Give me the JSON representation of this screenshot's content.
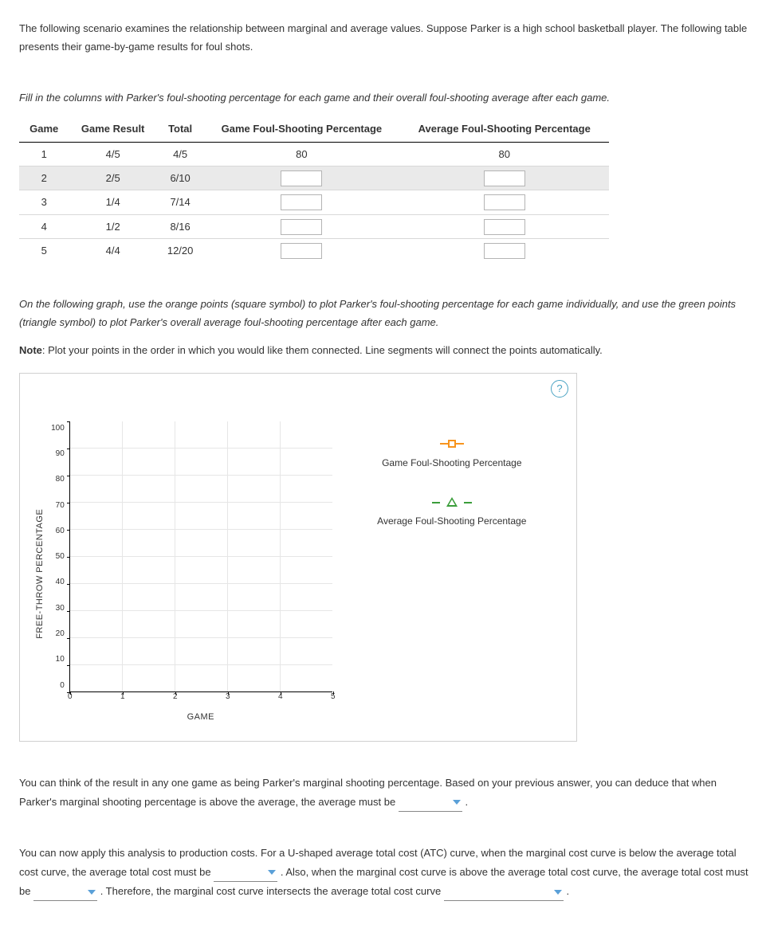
{
  "intro": "The following scenario examines the relationship between marginal and average values. Suppose Parker is a high school basketball player. The following table presents their game-by-game results for foul shots.",
  "table_instruction": "Fill in the columns with Parker's foul-shooting percentage for each game and their overall foul-shooting average after each game.",
  "table": {
    "headers": [
      "Game",
      "Game Result",
      "Total",
      "Game Foul-Shooting Percentage",
      "Average Foul-Shooting Percentage"
    ],
    "rows": [
      {
        "game": "1",
        "result": "4/5",
        "total": "4/5",
        "game_pct": "80",
        "avg_pct": "80",
        "inputs": false
      },
      {
        "game": "2",
        "result": "2/5",
        "total": "6/10",
        "game_pct": "",
        "avg_pct": "",
        "inputs": true,
        "selected": true
      },
      {
        "game": "3",
        "result": "1/4",
        "total": "7/14",
        "game_pct": "",
        "avg_pct": "",
        "inputs": true
      },
      {
        "game": "4",
        "result": "1/2",
        "total": "8/16",
        "game_pct": "",
        "avg_pct": "",
        "inputs": true
      },
      {
        "game": "5",
        "result": "4/4",
        "total": "12/20",
        "game_pct": "",
        "avg_pct": "",
        "inputs": true
      }
    ]
  },
  "graph_instruction": "On the following graph, use the orange points (square symbol) to plot Parker's foul-shooting percentage for each game individually, and use the green points (triangle symbol) to plot Parker's overall average foul-shooting percentage after each game.",
  "note_label": "Note",
  "note_text": ": Plot your points in the order in which you would like them connected. Line segments will connect the points automatically.",
  "chart_data": {
    "type": "scatter",
    "title": "",
    "xlabel": "GAME",
    "ylabel": "FREE-THROW PERCENTAGE",
    "xlim": [
      0,
      5
    ],
    "ylim": [
      0,
      100
    ],
    "xticks": [
      "0",
      "1",
      "2",
      "3",
      "4",
      "5"
    ],
    "yticks": [
      "100",
      "90",
      "80",
      "70",
      "60",
      "50",
      "40",
      "30",
      "20",
      "10",
      "0"
    ],
    "series": [
      {
        "name": "Game Foul-Shooting Percentage",
        "symbol": "square",
        "color": "#f7941d",
        "values": []
      },
      {
        "name": "Average Foul-Shooting Percentage",
        "symbol": "triangle",
        "color": "#3a9d3a",
        "values": []
      }
    ]
  },
  "help_symbol": "?",
  "q1_a": "You can think of the result in any one game as being Parker's marginal shooting percentage. Based on your previous answer, you can deduce that when Parker's marginal shooting percentage is above the average, the average must be ",
  "q1_b": " .",
  "q2_a": "You can now apply this analysis to production costs. For a U-shaped average total cost (ATC) curve, when the marginal cost curve is below the average total cost curve, the average total cost must be ",
  "q2_b": " . Also, when the marginal cost curve is above the average total cost curve, the average total cost must be ",
  "q2_c": " . Therefore, the marginal cost curve intersects the average total cost curve ",
  "q2_d": " ."
}
